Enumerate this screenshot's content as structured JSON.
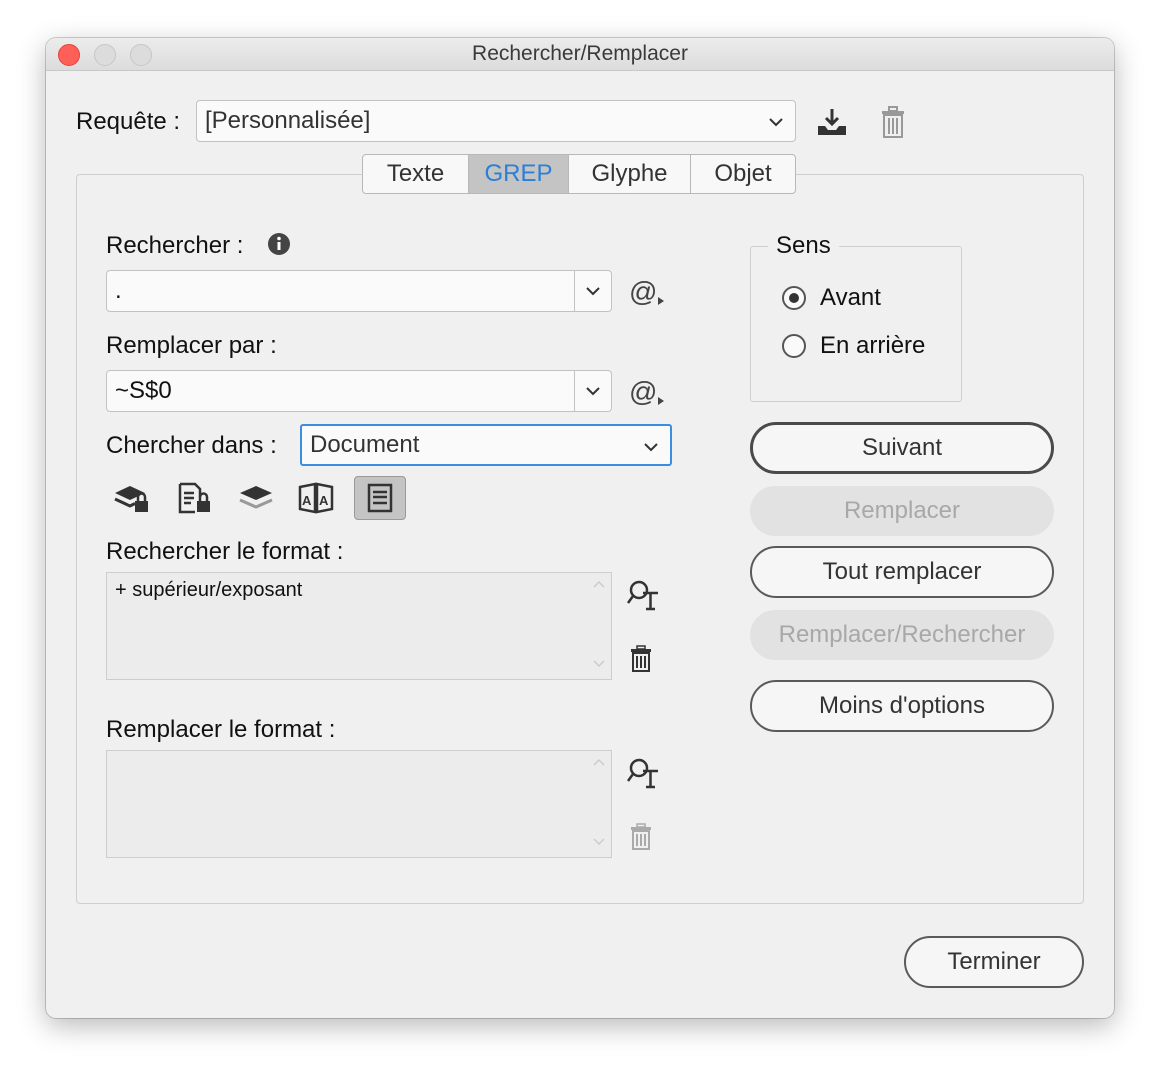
{
  "window": {
    "title": "Rechercher/Remplacer"
  },
  "query": {
    "label": "Requête :",
    "value": "[Personnalisée]"
  },
  "tabs": [
    {
      "label": "Texte",
      "active": false
    },
    {
      "label": "GREP",
      "active": true
    },
    {
      "label": "Glyphe",
      "active": false
    },
    {
      "label": "Objet",
      "active": false
    }
  ],
  "find": {
    "label": "Rechercher :",
    "value": "."
  },
  "replace": {
    "label": "Remplacer par :",
    "value": "~S$0"
  },
  "search_in": {
    "label": "Chercher dans :",
    "value": "Document"
  },
  "find_format": {
    "label": "Rechercher le format :",
    "value": "+ supérieur/exposant"
  },
  "replace_format": {
    "label": "Remplacer le format :",
    "value": ""
  },
  "direction": {
    "label": "Sens",
    "options": [
      {
        "label": "Avant",
        "selected": true
      },
      {
        "label": "En arrière",
        "selected": false
      }
    ]
  },
  "buttons": {
    "next": "Suivant",
    "replace": "Remplacer",
    "replace_all": "Tout remplacer",
    "replace_find": "Remplacer/Rechercher",
    "fewer_options": "Moins d'options",
    "done": "Terminer"
  },
  "colors": {
    "accent": "#2a7fd6",
    "close": "#fe5f57"
  }
}
